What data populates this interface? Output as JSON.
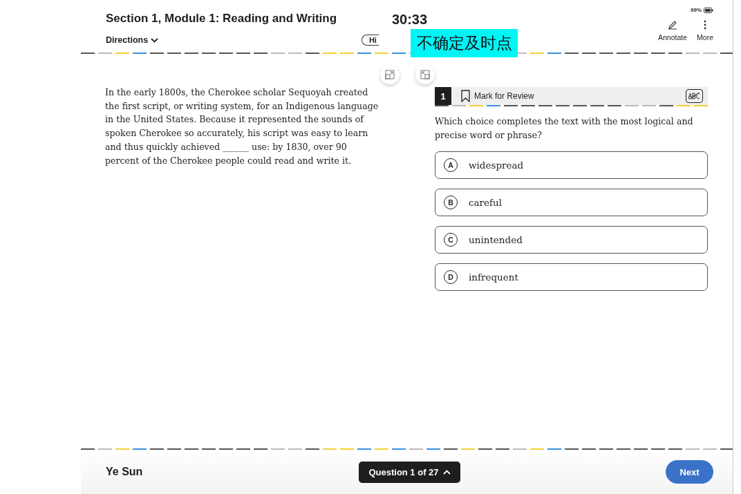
{
  "header": {
    "section_title": "Section 1, Module 1: Reading and Writing",
    "directions": "Directions",
    "timer": "30:33",
    "hide_button": "Hi",
    "battery": "99%",
    "tools": [
      {
        "label": "Annotate",
        "kind": "pen"
      },
      {
        "label": "More",
        "kind": "dots"
      }
    ]
  },
  "passage": "In the early 1800s, the Cherokee scholar Sequoyah created the first script, or writing system, for an Indigenous language in the United States. Because it represented the sounds of spoken Cherokee so accurately, his script was easy to learn and thus quickly achieved ______ use: by 1830, over 90 percent of the Cherokee people could read and write it.",
  "question": {
    "number": "1",
    "mark_for_review": "Mark for Review",
    "marked": false,
    "prompt": "Which choice completes the text with the most logical and precise word or phrase?",
    "choices": [
      {
        "letter": "A",
        "text": "widespread",
        "selected": false
      },
      {
        "letter": "B",
        "text": "careful",
        "selected": false
      },
      {
        "letter": "C",
        "text": "unintended",
        "selected": false
      },
      {
        "letter": "D",
        "text": "infrequent",
        "selected": false
      }
    ]
  },
  "footer": {
    "student": "Ye Sun",
    "navigator": "Question 1 of 27",
    "next": "Next"
  },
  "annotation": {
    "note": "不确定及时点"
  }
}
